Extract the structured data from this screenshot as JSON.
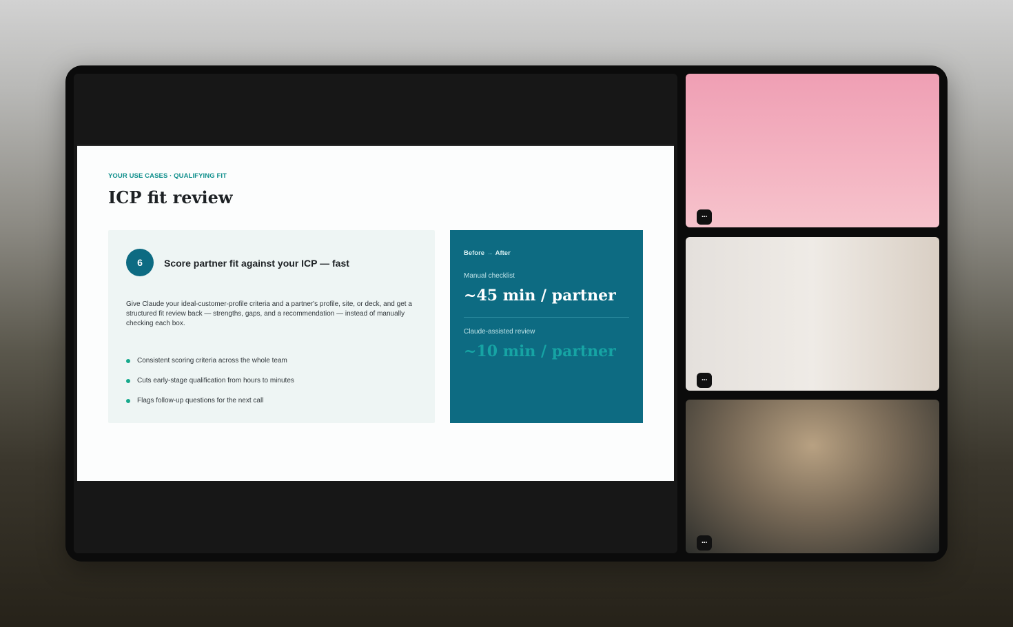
{
  "slide": {
    "eyebrow": "YOUR USE CASES · QUALIFYING FIT",
    "title": "ICP fit review",
    "card": {
      "step_number": "6",
      "heading": "Score partner fit against your ICP — fast",
      "description": "Give Claude your ideal-customer-profile criteria and a partner's profile, site, or deck, and get a structured fit review back — strengths, gaps, and a recommendation — instead of manually checking each box.",
      "bullets": [
        "Consistent scoring criteria across the whole team",
        "Cuts early-stage qualification from hours to minutes",
        "Flags follow-up questions for the next call"
      ]
    },
    "panel": {
      "before_word": "Before",
      "arrow": "→",
      "after_word": "After",
      "before_label": "Manual checklist",
      "before_value": "~45 min / partner",
      "after_label": "Claude-assisted review",
      "after_value": "~10 min / partner"
    }
  },
  "participants": [
    {
      "more_label": "···"
    },
    {
      "more_label": "···"
    },
    {
      "more_label": "···"
    }
  ],
  "colors": {
    "accent_teal": "#0f8f8c",
    "panel_bg": "#0d6b82",
    "bullet_dot": "#17a98c"
  }
}
